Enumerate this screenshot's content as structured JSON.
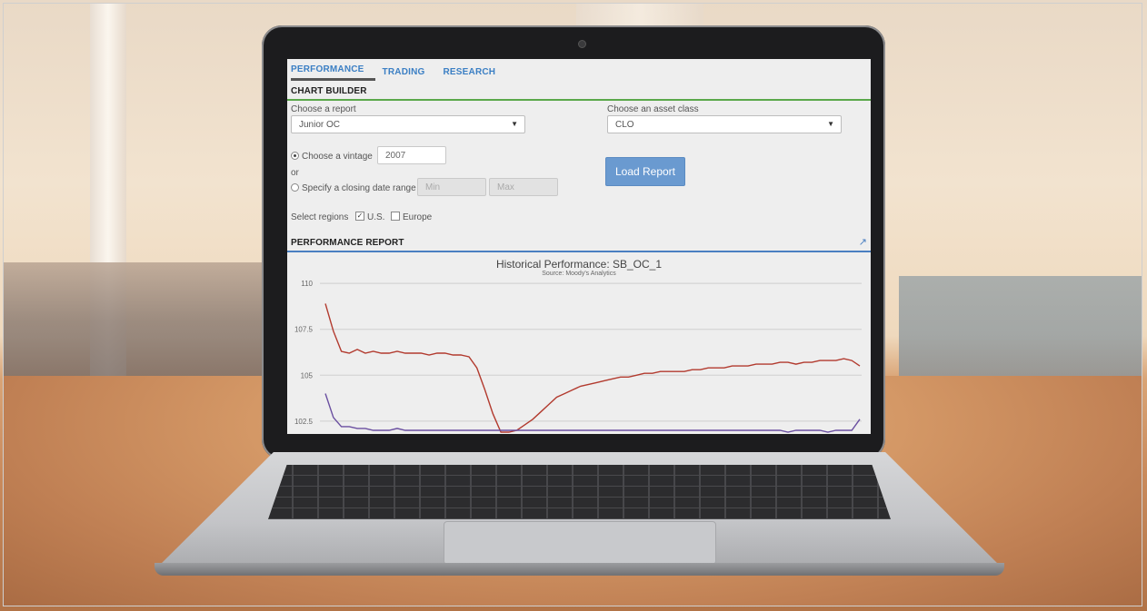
{
  "tabs": [
    {
      "label": "PERFORMANCE",
      "active": true
    },
    {
      "label": "TRADING",
      "active": false
    },
    {
      "label": "RESEARCH",
      "active": false
    }
  ],
  "builder": {
    "heading": "CHART BUILDER",
    "report_label": "Choose a report",
    "report_value": "Junior OC",
    "asset_label": "Choose an asset class",
    "asset_value": "CLO",
    "vintage_label": "Choose a vintage",
    "vintage_value": "2007",
    "or_label": "or",
    "date_range_label": "Specify a closing date range",
    "min_placeholder": "Min",
    "max_placeholder": "Max",
    "regions_label": "Select regions",
    "region_us": "U.S.",
    "region_europe": "Europe",
    "load_button": "Load Report"
  },
  "performance": {
    "heading": "PERFORMANCE REPORT"
  },
  "chart_data": {
    "type": "line",
    "title": "Historical Performance: SB_OC_1",
    "subtitle": "Source: Moody's Analytics",
    "ylim": [
      101.8,
      110.5
    ],
    "yticks": [
      "110",
      "107.5",
      "105",
      "102.5"
    ],
    "ytick_values": [
      110,
      107.5,
      105,
      102.5
    ],
    "grid": true,
    "series": [
      {
        "color": "#b23a2e",
        "values": [
          108.9,
          107.4,
          106.3,
          106.2,
          106.4,
          106.2,
          106.3,
          106.2,
          106.2,
          106.3,
          106.2,
          106.2,
          106.2,
          106.1,
          106.2,
          106.2,
          106.1,
          106.1,
          106.0,
          105.4,
          104.2,
          102.9,
          101.9,
          101.9,
          102.0,
          102.3,
          102.6,
          103.0,
          103.4,
          103.8,
          104.0,
          104.2,
          104.4,
          104.5,
          104.6,
          104.7,
          104.8,
          104.9,
          104.9,
          105.0,
          105.1,
          105.1,
          105.2,
          105.2,
          105.2,
          105.2,
          105.3,
          105.3,
          105.4,
          105.4,
          105.4,
          105.5,
          105.5,
          105.5,
          105.6,
          105.6,
          105.6,
          105.7,
          105.7,
          105.6,
          105.7,
          105.7,
          105.8,
          105.8,
          105.8,
          105.9,
          105.8,
          105.5
        ]
      },
      {
        "color": "#6a4fa0",
        "values": [
          104.0,
          102.7,
          102.2,
          102.2,
          102.1,
          102.1,
          102.0,
          102.0,
          102.0,
          102.1,
          102.0,
          102.0,
          102.0,
          102.0,
          102.0,
          102.0,
          102.0,
          102.0,
          102.0,
          102.0,
          102.0,
          102.0,
          102.0,
          102.0,
          102.0,
          102.0,
          102.0,
          102.0,
          102.0,
          102.0,
          102.0,
          102.0,
          102.0,
          102.0,
          102.0,
          102.0,
          102.0,
          102.0,
          102.0,
          102.0,
          102.0,
          102.0,
          102.0,
          102.0,
          102.0,
          102.0,
          102.0,
          102.0,
          102.0,
          102.0,
          102.0,
          102.0,
          102.0,
          102.0,
          102.0,
          102.0,
          102.0,
          102.0,
          101.9,
          102.0,
          102.0,
          102.0,
          102.0,
          101.9,
          102.0,
          102.0,
          102.0,
          102.6
        ]
      }
    ]
  }
}
